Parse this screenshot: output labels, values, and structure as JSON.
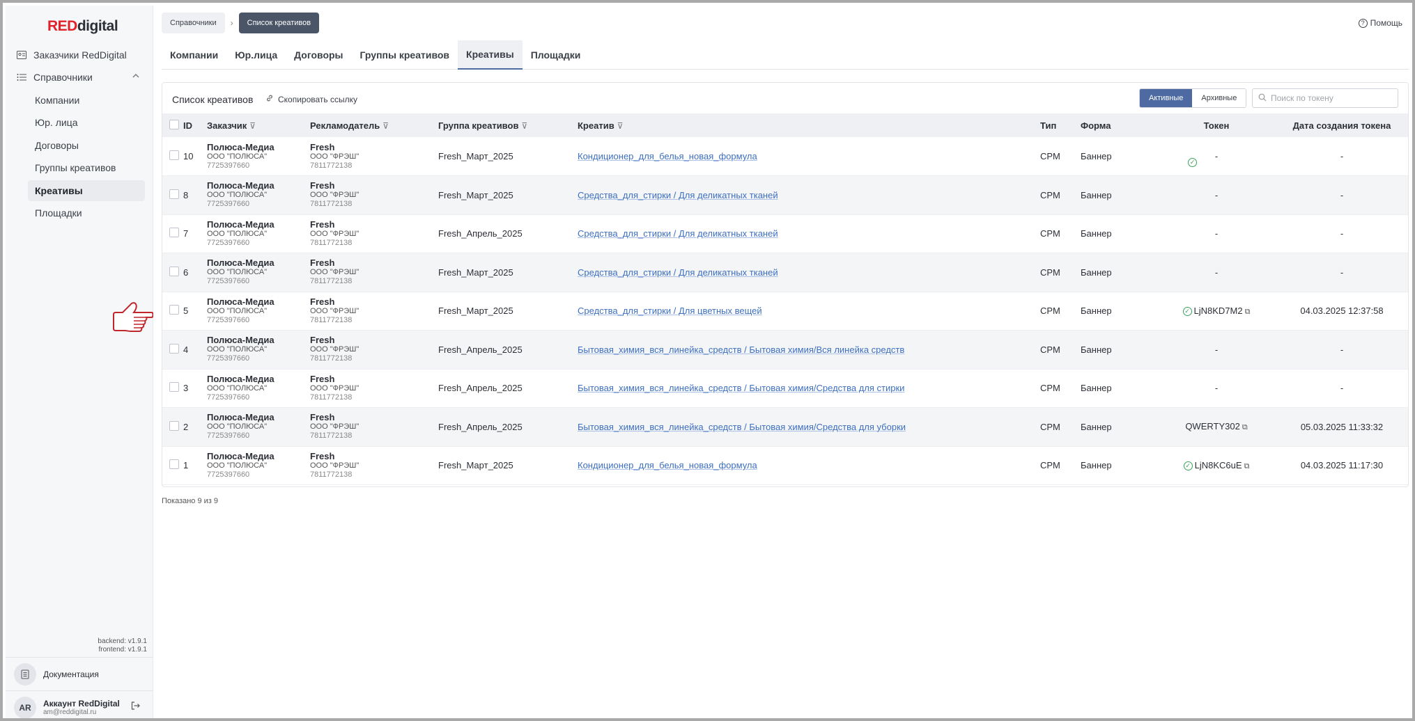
{
  "logo": {
    "red": "RED",
    "rest": "digital"
  },
  "sidebar": {
    "customers": "Заказчики RedDigital",
    "group": "Справочники",
    "items": [
      "Компании",
      "Юр. лица",
      "Договоры",
      "Группы креативов",
      "Креативы",
      "Площадки"
    ],
    "backend": "backend: v1.9.1",
    "frontend": "frontend: v1.9.1",
    "docs": "Документация",
    "account_initials": "AR",
    "account_name": "Аккаунт RedDigital",
    "account_email": "am@reddigital.ru"
  },
  "breadcrumbs": {
    "first": "Справочники",
    "current": "Список креативов"
  },
  "help": "Помощь",
  "tabs": [
    "Компании",
    "Юр.лица",
    "Договоры",
    "Группы креативов",
    "Креативы",
    "Площадки"
  ],
  "panel": {
    "title": "Список креативов",
    "copy_link": "Скопировать ссылку",
    "active": "Активные",
    "archived": "Архивные",
    "search_placeholder": "Поиск по токену"
  },
  "columns": [
    "ID",
    "Заказчик",
    "Рекламодатель",
    "Группа креативов",
    "Креатив",
    "Тип",
    "Форма",
    "Токен",
    "Дата создания токена"
  ],
  "rows": [
    {
      "id": "10",
      "cust": "Полюса-Медиа",
      "cust_org": "ООО \"ПОЛЮСА\"",
      "cust_inn": "7725397660",
      "adv": "Fresh",
      "adv_org": "ООО \"ФРЭШ\"",
      "adv_inn": "7811772138",
      "group": "Fresh_Март_2025",
      "creative": "Кондиционер_для_белья_новая_формула",
      "type": "CPM",
      "form": "Баннер",
      "token": "-",
      "date": "-"
    },
    {
      "id": "8",
      "cust": "Полюса-Медиа",
      "cust_org": "ООО \"ПОЛЮСА\"",
      "cust_inn": "7725397660",
      "adv": "Fresh",
      "adv_org": "ООО \"ФРЭШ\"",
      "adv_inn": "7811772138",
      "group": "Fresh_Март_2025",
      "creative": "Средства_для_стирки / Для деликатных тканей",
      "type": "CPM",
      "form": "Баннер",
      "token": "-",
      "date": "-"
    },
    {
      "id": "7",
      "cust": "Полюса-Медиа",
      "cust_org": "ООО \"ПОЛЮСА\"",
      "cust_inn": "7725397660",
      "adv": "Fresh",
      "adv_org": "ООО \"ФРЭШ\"",
      "adv_inn": "7811772138",
      "group": "Fresh_Апрель_2025",
      "creative": "Средства_для_стирки / Для деликатных тканей",
      "type": "CPM",
      "form": "Баннер",
      "token": "-",
      "date": "-"
    },
    {
      "id": "6",
      "cust": "Полюса-Медиа",
      "cust_org": "ООО \"ПОЛЮСА\"",
      "cust_inn": "7725397660",
      "adv": "Fresh",
      "adv_org": "ООО \"ФРЭШ\"",
      "adv_inn": "7811772138",
      "group": "Fresh_Март_2025",
      "creative": "Средства_для_стирки / Для деликатных тканей",
      "type": "CPM",
      "form": "Баннер",
      "token": "-",
      "date": "-"
    },
    {
      "id": "5",
      "cust": "Полюса-Медиа",
      "cust_org": "ООО \"ПОЛЮСА\"",
      "cust_inn": "7725397660",
      "adv": "Fresh",
      "adv_org": "ООО \"ФРЭШ\"",
      "adv_inn": "7811772138",
      "group": "Fresh_Март_2025",
      "creative": "Средства_для_стирки / Для цветных вещей",
      "type": "CPM",
      "form": "Баннер",
      "token": "LjN8KD7M2",
      "date": "04.03.2025 12:37:58"
    },
    {
      "id": "4",
      "cust": "Полюса-Медиа",
      "cust_org": "ООО \"ПОЛЮСА\"",
      "cust_inn": "7725397660",
      "adv": "Fresh",
      "adv_org": "ООО \"ФРЭШ\"",
      "adv_inn": "7811772138",
      "group": "Fresh_Апрель_2025",
      "creative": "Бытовая_химия_вся_линейка_средств / Бытовая химия/Вся линейка средств",
      "type": "CPM",
      "form": "Баннер",
      "token": "-",
      "date": "-"
    },
    {
      "id": "3",
      "cust": "Полюса-Медиа",
      "cust_org": "ООО \"ПОЛЮСА\"",
      "cust_inn": "7725397660",
      "adv": "Fresh",
      "adv_org": "ООО \"ФРЭШ\"",
      "adv_inn": "7811772138",
      "group": "Fresh_Апрель_2025",
      "creative": "Бытовая_химия_вся_линейка_средств / Бытовая химия/Средства для стирки",
      "type": "CPM",
      "form": "Баннер",
      "token": "-",
      "date": "-"
    },
    {
      "id": "2",
      "cust": "Полюса-Медиа",
      "cust_org": "ООО \"ПОЛЮСА\"",
      "cust_inn": "7725397660",
      "adv": "Fresh",
      "adv_org": "ООО \"ФРЭШ\"",
      "adv_inn": "7811772138",
      "group": "Fresh_Апрель_2025",
      "creative": "Бытовая_химия_вся_линейка_средств / Бытовая химия/Средства для уборки",
      "type": "CPM",
      "form": "Баннер",
      "token": "QWERTY302",
      "date": "05.03.2025 11:33:32"
    },
    {
      "id": "1",
      "cust": "Полюса-Медиа",
      "cust_org": "ООО \"ПОЛЮСА\"",
      "cust_inn": "7725397660",
      "adv": "Fresh",
      "adv_org": "ООО \"ФРЭШ\"",
      "adv_inn": "7811772138",
      "group": "Fresh_Март_2025",
      "creative": "Кондиционер_для_белья_новая_формула",
      "type": "CPM",
      "form": "Баннер",
      "token": "LjN8KC6uE",
      "date": "04.03.2025 11:17:30"
    }
  ],
  "shown": "Показано 9 из 9",
  "colors": {
    "brand_red": "#e0222a",
    "accent_blue": "#4d6aa3",
    "link": "#3d6fc0",
    "ok_green": "#3aa55a"
  }
}
